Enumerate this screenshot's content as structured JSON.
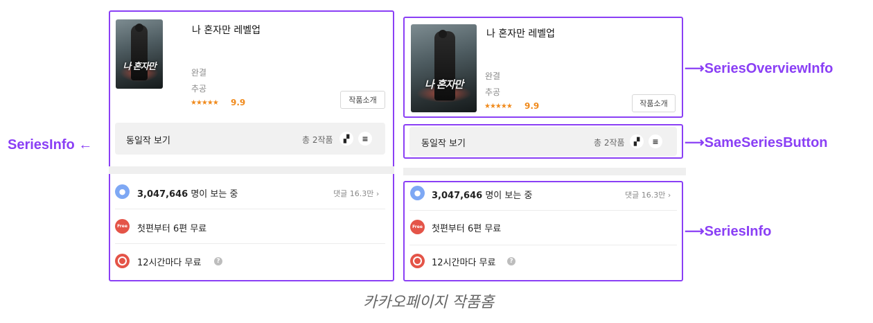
{
  "series": {
    "title": "나 혼자만 레벨업",
    "status": "완결",
    "genre": "추공",
    "stars": "★★★★★",
    "rating": "9.9",
    "intro_button": "작품소개",
    "cover_title": "나 혼자만"
  },
  "same_series": {
    "label": "동일작 보기",
    "count": "총 2작품",
    "icon_a": "▞",
    "icon_b": "≡"
  },
  "info": {
    "viewers_count": "3,047,646",
    "viewers_suffix": " 명이 보는 중",
    "comments": "댓글 16.3만 ›",
    "free_badge": "Free",
    "free_text": "첫편부터 6편 무료",
    "wait_text": "12시간마다 무료",
    "help_glyph": "?"
  },
  "labels": {
    "series_info_left": "SeriesInfo ←",
    "overview": "⟶SeriesOverviewInfo",
    "same_series_button": "⟶SameSeriesButton",
    "series_info_right": "⟶SeriesInfo"
  },
  "caption": "카카오페이지 작품홈",
  "colors": {
    "accent": "#8a3ff5",
    "rating": "#f08a1c",
    "badge_red": "#e45448",
    "badge_blue": "#7ea8f4"
  },
  "icons": [
    "chat-bubble-icon",
    "free-badge-icon",
    "clock-icon",
    "help-icon",
    "page-view-icon",
    "list-view-icon",
    "chevron-right-icon"
  ]
}
